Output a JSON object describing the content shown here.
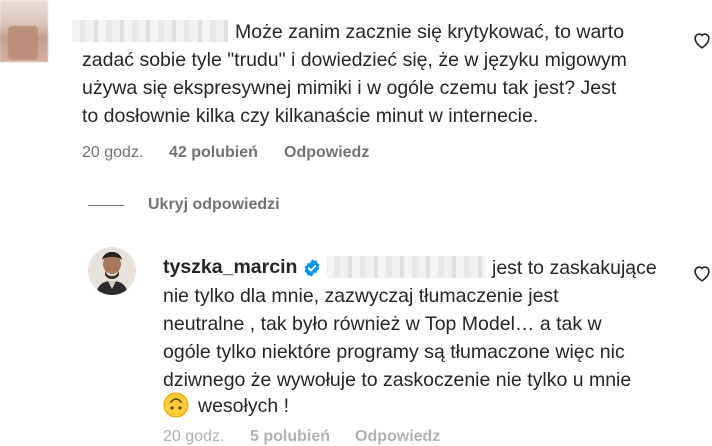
{
  "comment1": {
    "text_lines": [
      "Może zanim zacznie się krytykować, to warto",
      "zadać sobie tyle \"trudu\" i dowiedzieć się, że w języku migowym",
      "używa się ekspresywnej mimiki i w ogóle czemu tak jest? Jest",
      "to dosłownie kilka czy kilkanaście minut w internecie."
    ],
    "time": "20 godz.",
    "likes": "42 polubień",
    "reply_label": "Odpowiedz"
  },
  "hide_replies_label": "Ukryj odpowiedzi",
  "reply1": {
    "username": "tyszka_marcin",
    "text_first": "jest to zaskakujące",
    "text_lines": [
      "nie tylko dla mnie, zazwyczaj tłumaczenie jest",
      "neutralne , tak było również w Top Model… a tak w",
      "ogóle tylko niektóre programy są tłumaczone więc nic",
      "dziwnego że wywołuje to zaskoczenie nie tylko u mnie"
    ],
    "emoji": "🙃",
    "text_last": "wesołych !",
    "time": "20 godz.",
    "likes": "5 polubień",
    "reply_label": "Odpowiedz"
  },
  "colors": {
    "text": "#262626",
    "secondary": "#737373",
    "verified": "#0095f6"
  },
  "icons": [
    "heart-icon",
    "verified-badge-icon"
  ]
}
